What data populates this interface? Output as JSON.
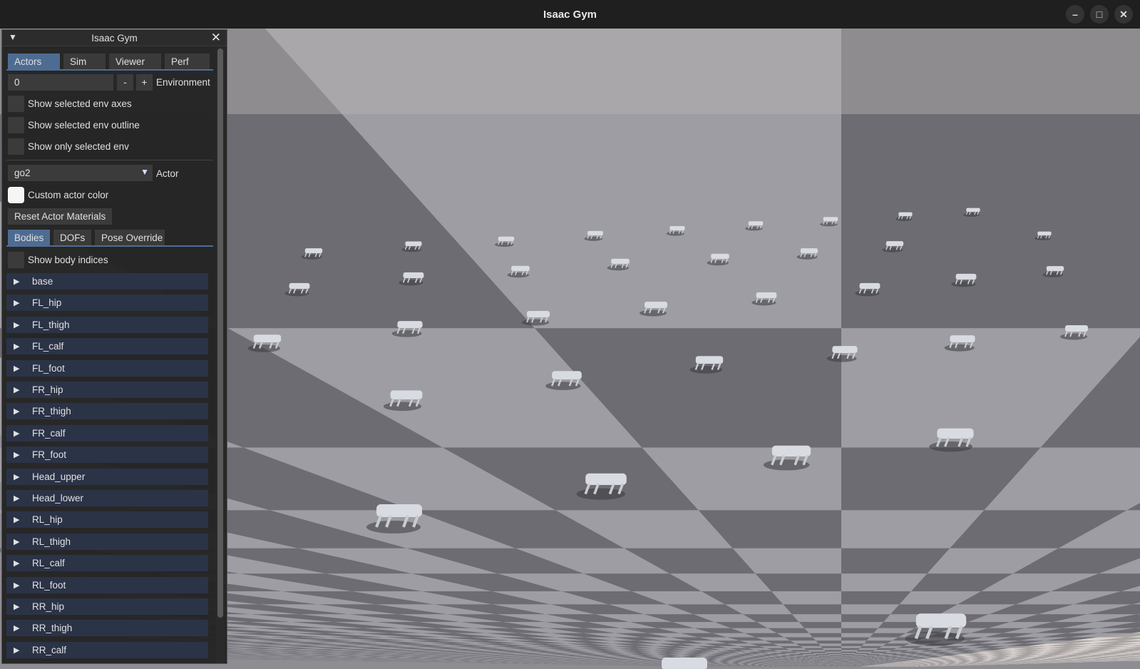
{
  "window": {
    "title": "Isaac Gym"
  },
  "panel": {
    "title": "Isaac Gym",
    "tabs": [
      "Actors",
      "Sim",
      "Viewer",
      "Perf"
    ],
    "env": {
      "value": "0",
      "minus": "-",
      "plus": "+",
      "label": "Environment"
    },
    "checks": [
      "Show selected env axes",
      "Show selected env outline",
      "Show only selected env"
    ],
    "actor": {
      "value": "go2",
      "label": "Actor"
    },
    "custom_color": "Custom actor color",
    "reset_btn": "Reset Actor Materials",
    "subtabs": [
      "Bodies",
      "DOFs",
      "Pose Override"
    ],
    "show_indices": "Show body indices",
    "bodies": [
      "base",
      "FL_hip",
      "FL_thigh",
      "FL_calf",
      "FL_foot",
      "FR_hip",
      "FR_thigh",
      "FR_calf",
      "FR_foot",
      "Head_upper",
      "Head_lower",
      "RL_hip",
      "RL_thigh",
      "RL_calf",
      "RL_foot",
      "RR_hip",
      "RR_thigh",
      "RR_calf"
    ]
  },
  "icons": [
    "collapse-triangle-icon",
    "close-icon",
    "dropdown-arrow-icon",
    "tree-arrow-icon",
    "minimize-icon",
    "maximize-icon",
    "window-close-icon"
  ],
  "colors": {
    "accent": "#4e6c92",
    "tree_row": "#2b3347",
    "panel_bg": "#242424"
  }
}
